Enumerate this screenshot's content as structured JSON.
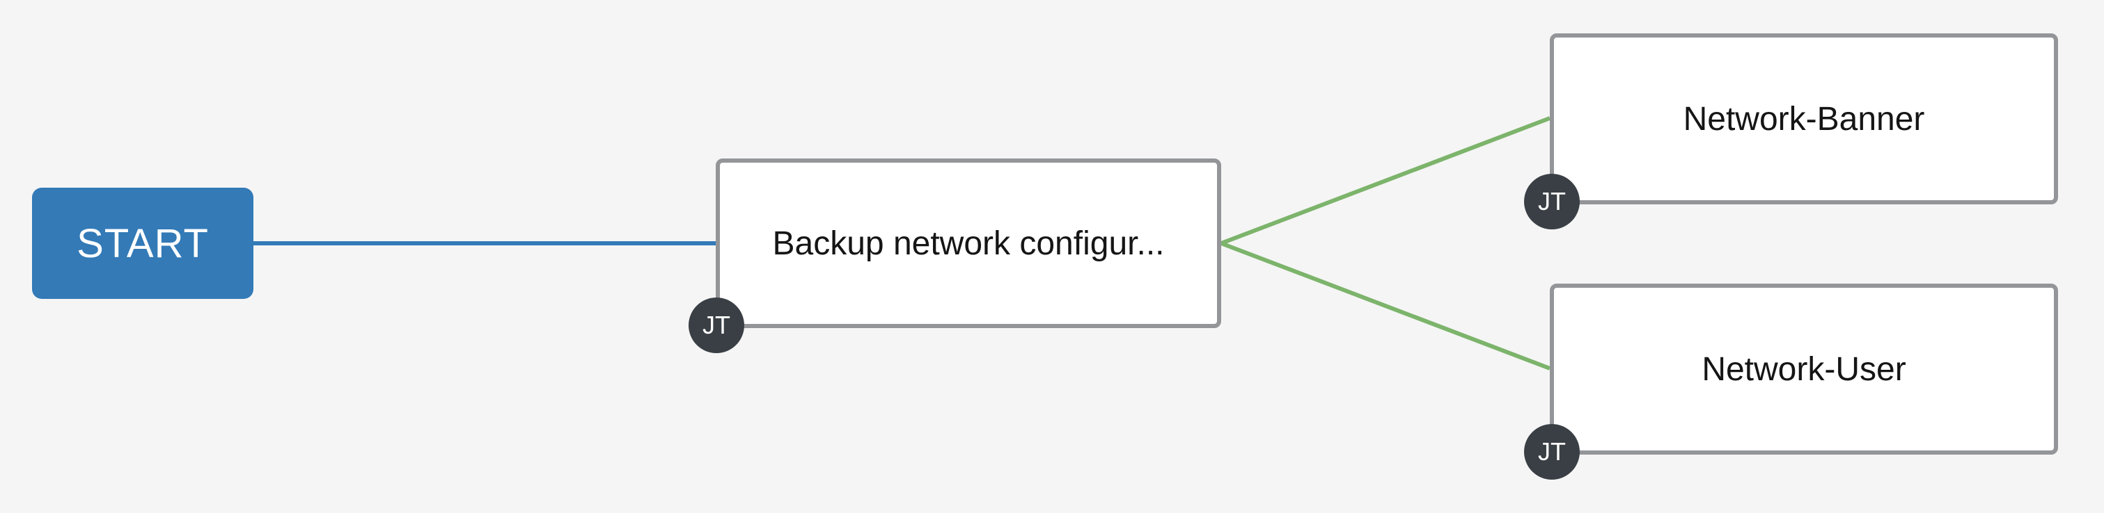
{
  "workflow": {
    "start_label": "START",
    "nodes": [
      {
        "id": "backup",
        "label": "Backup network configur...",
        "badge": "JT"
      },
      {
        "id": "banner",
        "label": "Network-Banner",
        "badge": "JT"
      },
      {
        "id": "user",
        "label": "Network-User",
        "badge": "JT"
      }
    ]
  },
  "colors": {
    "background": "#f5f5f5",
    "start_node": "#337ab7",
    "always_link": "#337ab7",
    "success_link": "#7cb46b",
    "node_border": "#939598",
    "badge": "#393f44"
  }
}
